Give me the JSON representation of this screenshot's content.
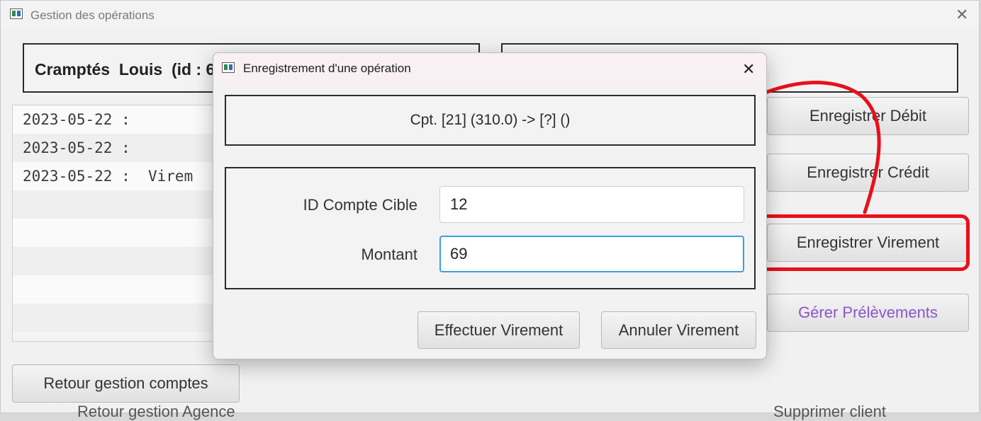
{
  "main_window": {
    "title": "Gestion des opérations",
    "account_label": "Cramptés  Louis  (id : 6",
    "operations": [
      "2023-05-22 :",
      "2023-05-22 :",
      "2023-05-22 :  Virem",
      "",
      "",
      "",
      "",
      ""
    ],
    "buttons": {
      "debit": "Enregistrer Débit",
      "credit": "Enregistrer Crédit",
      "virement": "Enregistrer Virement",
      "prelevements": "Gérer Prélèvements",
      "retour": "Retour gestion comptes"
    },
    "footer_peek_left": "Retour gestion Agence",
    "footer_peek_right": "Supprimer client"
  },
  "dialog": {
    "title": "Enregistrement d'une opération",
    "summary": "Cpt. [21] (310.0) -> [?] ()",
    "fields": {
      "target_label": "ID Compte Cible",
      "target_value": "12",
      "amount_label": "Montant",
      "amount_value": "69"
    },
    "buttons": {
      "confirm": "Effectuer Virement",
      "cancel": "Annuler Virement"
    }
  },
  "annotation": {
    "color": "#e8101a"
  }
}
